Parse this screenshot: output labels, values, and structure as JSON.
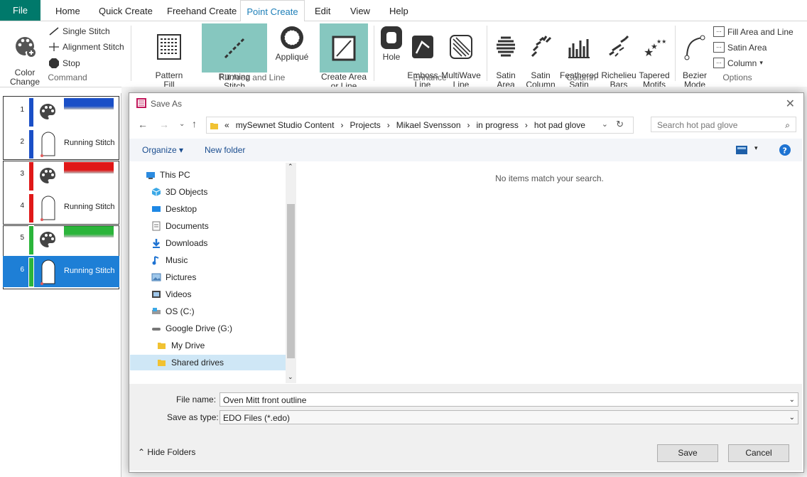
{
  "ribbon_tabs": [
    "File",
    "Home",
    "Quick Create",
    "Freehand Create",
    "Point Create",
    "Edit",
    "View",
    "Help"
  ],
  "ribbon": {
    "command": {
      "color_change": "Color\nChange",
      "single_stitch": "Single Stitch",
      "alignment_stitch": "Alignment Stitch",
      "stop": "Stop",
      "group": "Command"
    },
    "fill": {
      "pattern_fill": "Pattern\nFill",
      "running_stitch": "Running\nStitch",
      "applique": "Appliqué",
      "create_area": "Create Area\nor Line",
      "group": "Fill Area and Line"
    },
    "enhance": {
      "hole": "Hole",
      "emboss_line": "Emboss\nLine",
      "multiwave": "MultiWave\nLine",
      "group": "Enhance"
    },
    "column": {
      "satin_area": "Satin\nArea",
      "satin_column": "Satin\nColumn",
      "feathered": "Feathered\nSatin",
      "richelieu": "Richelieu\nBars",
      "tapered": "Tapered\nMotifs",
      "group": "Column"
    },
    "options": {
      "bezier": "Bezier\nMode",
      "fill_area_line": "Fill Area and Line",
      "satin_area": "Satin Area",
      "column": "Column",
      "group": "Options"
    }
  },
  "layers": [
    {
      "num": "1",
      "type": "color",
      "color": "#1a4fc7",
      "bar": "#1a4fc7"
    },
    {
      "num": "2",
      "type": "stitch",
      "label": "Running Stitch",
      "bar": "#1a4fc7"
    },
    {
      "num": "3",
      "type": "color",
      "color": "#e01818",
      "bar": "#e01818"
    },
    {
      "num": "4",
      "type": "stitch",
      "label": "Running Stitch",
      "bar": "#e01818"
    },
    {
      "num": "5",
      "type": "color",
      "color": "#2bb53b",
      "bar": "#2bb53b"
    },
    {
      "num": "6",
      "type": "stitch",
      "label": "Running Stitch",
      "bar": "#2bb53b",
      "selected": true
    }
  ],
  "dialog": {
    "title": "Save As",
    "breadcrumb": [
      "«",
      "mySewnet Studio Content",
      "›",
      "Projects",
      "›",
      "Mikael Svensson",
      "›",
      "in progress",
      "›",
      "hot pad glove"
    ],
    "search_placeholder": "Search hot pad glove",
    "organize": "Organize ▾",
    "new_folder": "New folder",
    "nav_items": [
      {
        "label": "This PC",
        "icon": "pc-icon",
        "indent": 0
      },
      {
        "label": "3D Objects",
        "icon": "cube-icon",
        "indent": 1
      },
      {
        "label": "Desktop",
        "icon": "desktop-icon",
        "indent": 1
      },
      {
        "label": "Documents",
        "icon": "document-icon",
        "indent": 1
      },
      {
        "label": "Downloads",
        "icon": "download-icon",
        "indent": 1
      },
      {
        "label": "Music",
        "icon": "music-icon",
        "indent": 1
      },
      {
        "label": "Pictures",
        "icon": "picture-icon",
        "indent": 1
      },
      {
        "label": "Videos",
        "icon": "video-icon",
        "indent": 1
      },
      {
        "label": "OS (C:)",
        "icon": "drive-icon",
        "indent": 1
      },
      {
        "label": "Google Drive (G:)",
        "icon": "gdrive-icon",
        "indent": 1
      },
      {
        "label": "My Drive",
        "icon": "folder-icon",
        "indent": 2
      },
      {
        "label": "Shared drives",
        "icon": "folder-icon",
        "indent": 2,
        "selected": true
      }
    ],
    "empty_message": "No items match your search.",
    "file_name_label": "File name:",
    "file_name_value": "Oven Mitt front outline",
    "save_type_label": "Save as type:",
    "save_type_value": "EDO Files (*.edo)",
    "hide_folders": "Hide Folders",
    "save": "Save",
    "cancel": "Cancel"
  }
}
